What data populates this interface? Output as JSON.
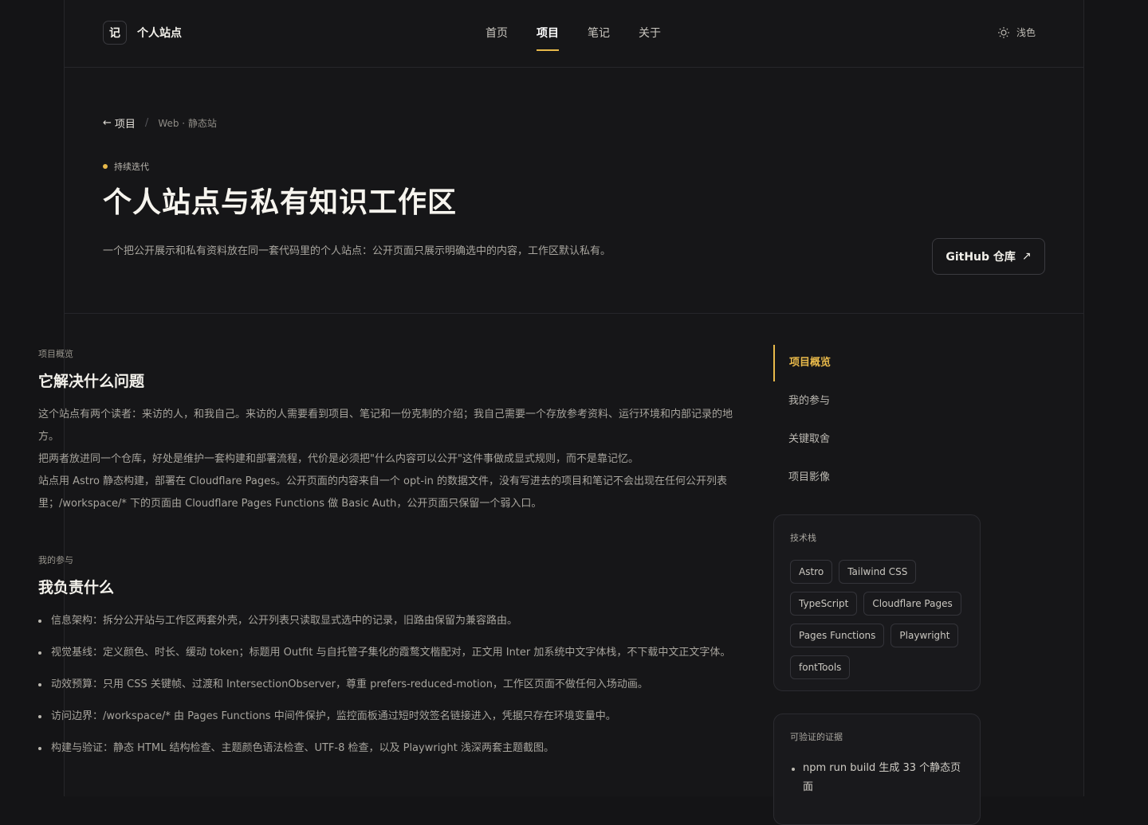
{
  "brand": {
    "logo_char": "记",
    "name": "个人站点"
  },
  "nav": [
    {
      "label": "首页",
      "active": false
    },
    {
      "label": "项目",
      "active": true
    },
    {
      "label": "笔记",
      "active": false
    },
    {
      "label": "关于",
      "active": false
    }
  ],
  "theme_toggle": {
    "label": "浅色",
    "icon": "sun-icon"
  },
  "breadcrumb": {
    "back_label": "项目",
    "category": "Web · 静态站"
  },
  "project": {
    "status": "持续迭代",
    "status_color": "#e8b94a",
    "title": "个人站点与私有知识工作区",
    "description": "一个把公开展示和私有资料放在同一套代码里的个人站点：公开页面只展示明确选中的内容，工作区默认私有。",
    "github_label": "GitHub 仓库"
  },
  "sections": {
    "overview": {
      "eyebrow": "项目概览",
      "heading": "它解决什么问题",
      "paragraphs": [
        "这个站点有两个读者：来访的人，和我自己。来访的人需要看到项目、笔记和一份克制的介绍；我自己需要一个存放参考资料、运行环境和内部记录的地方。",
        "把两者放进同一个仓库，好处是维护一套构建和部署流程，代价是必须把\"什么内容可以公开\"这件事做成显式规则，而不是靠记忆。",
        "站点用 Astro 静态构建，部署在 Cloudflare Pages。公开页面的内容来自一个 opt-in 的数据文件，没有写进去的项目和笔记不会出现在任何公开列表里；/workspace/* 下的页面由 Cloudflare Pages Functions 做 Basic Auth，公开页面只保留一个弱入口。"
      ]
    },
    "role": {
      "eyebrow": "我的参与",
      "heading": "我负责什么",
      "items": [
        "信息架构：拆分公开站与工作区两套外壳，公开列表只读取显式选中的记录，旧路由保留为兼容路由。",
        "视觉基线：定义颜色、时长、缓动 token；标题用 Outfit 与自托管子集化的霞鹜文楷配对，正文用 Inter 加系统中文字体栈，不下载中文正文字体。",
        "动效预算：只用 CSS 关键帧、过渡和 IntersectionObserver，尊重 prefers-reduced-motion，工作区页面不做任何入场动画。",
        "访问边界：/workspace/* 由 Pages Functions 中间件保护，监控面板通过短时效签名链接进入，凭据只存在环境变量中。",
        "构建与验证：静态 HTML 结构检查、主题颜色语法检查、UTF-8 检查，以及 Playwright 浅深两套主题截图。"
      ]
    }
  },
  "toc": [
    {
      "label": "项目概览",
      "active": true
    },
    {
      "label": "我的参与",
      "active": false
    },
    {
      "label": "关键取舍",
      "active": false
    },
    {
      "label": "项目影像",
      "active": false
    }
  ],
  "tech_stack": {
    "title": "技术栈",
    "tags": [
      "Astro",
      "Tailwind CSS",
      "TypeScript",
      "Cloudflare Pages",
      "Pages Functions",
      "Playwright",
      "fontTools"
    ]
  },
  "evidence": {
    "title": "可验证的证据",
    "items": [
      "npm run build 生成 33 个静态页面"
    ]
  }
}
